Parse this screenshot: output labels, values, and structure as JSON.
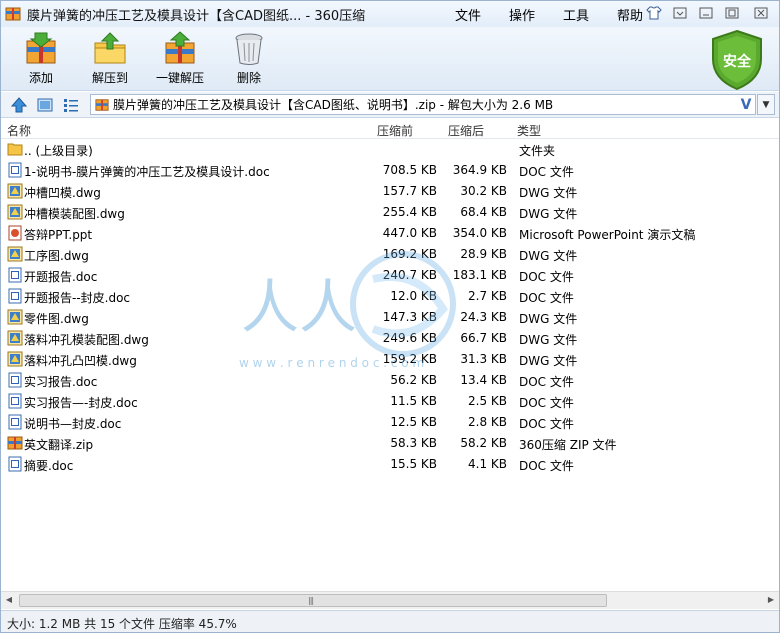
{
  "window": {
    "title": "膜片弹簧的冲压工艺及模具设计【含CAD图纸... - 360压缩",
    "menu": [
      "文件",
      "操作",
      "工具",
      "帮助"
    ]
  },
  "toolbar": {
    "add_label": "添加",
    "extract_label": "解压到",
    "oneclick_label": "一键解压",
    "delete_label": "删除",
    "security_label": "安全"
  },
  "address": {
    "path": "膜片弹簧的冲压工艺及模具设计【含CAD图纸、说明书】.zip - 解包大小为 2.6 MB",
    "check": "V"
  },
  "columns": {
    "name": "名称",
    "size": "压缩前",
    "packed": "压缩后",
    "type": "类型"
  },
  "files": [
    {
      "name": ".. (上级目录)",
      "size": "",
      "packed": "",
      "type": "文件夹",
      "icon": "folder-icon"
    },
    {
      "name": "1-说明书-膜片弹簧的冲压工艺及模具设计.doc",
      "size": "708.5 KB",
      "packed": "364.9 KB",
      "type": "DOC 文件",
      "icon": "doc-icon"
    },
    {
      "name": "冲槽凹模.dwg",
      "size": "157.7 KB",
      "packed": "30.2 KB",
      "type": "DWG 文件",
      "icon": "dwg-icon"
    },
    {
      "name": "冲槽模装配图.dwg",
      "size": "255.4 KB",
      "packed": "68.4 KB",
      "type": "DWG 文件",
      "icon": "dwg-icon"
    },
    {
      "name": "答辩PPT.ppt",
      "size": "447.0 KB",
      "packed": "354.0 KB",
      "type": "Microsoft PowerPoint 演示文稿",
      "icon": "ppt-icon"
    },
    {
      "name": "工序图.dwg",
      "size": "169.2 KB",
      "packed": "28.9 KB",
      "type": "DWG 文件",
      "icon": "dwg-icon"
    },
    {
      "name": "开题报告.doc",
      "size": "240.7 KB",
      "packed": "183.1 KB",
      "type": "DOC 文件",
      "icon": "doc-icon"
    },
    {
      "name": "开题报告--封皮.doc",
      "size": "12.0 KB",
      "packed": "2.7 KB",
      "type": "DOC 文件",
      "icon": "doc-icon"
    },
    {
      "name": "零件图.dwg",
      "size": "147.3 KB",
      "packed": "24.3 KB",
      "type": "DWG 文件",
      "icon": "dwg-icon"
    },
    {
      "name": "落料冲孔模装配图.dwg",
      "size": "249.6 KB",
      "packed": "66.7 KB",
      "type": "DWG 文件",
      "icon": "dwg-icon"
    },
    {
      "name": "落料冲孔凸凹模.dwg",
      "size": "159.2 KB",
      "packed": "31.3 KB",
      "type": "DWG 文件",
      "icon": "dwg-icon"
    },
    {
      "name": "实习报告.doc",
      "size": "56.2 KB",
      "packed": "13.4 KB",
      "type": "DOC 文件",
      "icon": "doc-icon"
    },
    {
      "name": "实习报告—-封皮.doc",
      "size": "11.5 KB",
      "packed": "2.5 KB",
      "type": "DOC 文件",
      "icon": "doc-icon"
    },
    {
      "name": "说明书—封皮.doc",
      "size": "12.5 KB",
      "packed": "2.8 KB",
      "type": "DOC 文件",
      "icon": "doc-icon"
    },
    {
      "name": "英文翻译.zip",
      "size": "58.3 KB",
      "packed": "58.2 KB",
      "type": "360压缩 ZIP 文件",
      "icon": "zip-icon"
    },
    {
      "name": "摘要.doc",
      "size": "15.5 KB",
      "packed": "4.1 KB",
      "type": "DOC 文件",
      "icon": "doc-icon"
    }
  ],
  "watermark": {
    "big": "人人",
    "url": "w w w . r e n r e n d o c . c o m"
  },
  "status": {
    "text": "大小: 1.2 MB 共 15 个文件 压缩率 45.7%"
  }
}
